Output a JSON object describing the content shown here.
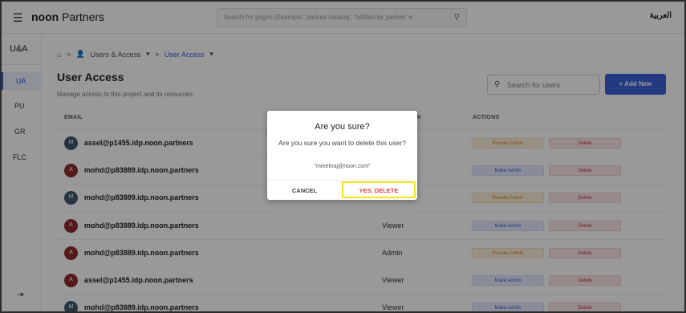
{
  "topbar": {
    "menu_icon": "hamburger-icon",
    "brand_bold": "noon",
    "brand_rest": " Partners",
    "search_placeholder": "Search for pages (Example: 'partner catalog', 'fulfilled by partner' e",
    "search_icon": "search-icon",
    "language": "العربية"
  },
  "rail": {
    "title": "U&A",
    "items": [
      {
        "label": "UA",
        "active": true
      },
      {
        "label": "PU"
      },
      {
        "label": "GR"
      },
      {
        "label": "FLC"
      }
    ],
    "collapse_label": "⇥"
  },
  "breadcrumb": {
    "home_icon": "home-icon",
    "sep": ">",
    "parent": "Users & Access",
    "current": "User Access",
    "chevron": "▾"
  },
  "page": {
    "title": "User Access",
    "subtitle": "Manage access to this project and its resources",
    "search_placeholder": "Search for users",
    "add_button": "+ Add New"
  },
  "table": {
    "headers": {
      "email": "EMAIL",
      "role": "N",
      "actions": "ACTIONS"
    },
    "rows": [
      {
        "initial": "M",
        "avatar_color": "#3e5a6e",
        "email": "assel@p1455.idp.noon.partners",
        "role": "",
        "admin_action": "Revoke Admin",
        "admin_type": "revoke",
        "delete": "Delete"
      },
      {
        "initial": "A",
        "avatar_color": "#8e2a2a",
        "email": "mohd@p83889.idp.noon.partners",
        "role": "",
        "admin_action": "Make Admin",
        "admin_type": "make",
        "delete": "Delete"
      },
      {
        "initial": "M",
        "avatar_color": "#3e5a6e",
        "email": "mohd@p83889.idp.noon.partners",
        "role": "",
        "admin_action": "Revoke Admin",
        "admin_type": "revoke",
        "delete": "Delete"
      },
      {
        "initial": "A",
        "avatar_color": "#8e2a2a",
        "email": "mohd@p83889.idp.noon.partners",
        "role": "Viewer",
        "admin_action": "Make Admin",
        "admin_type": "make",
        "delete": "Delete"
      },
      {
        "initial": "A",
        "avatar_color": "#8e2a2a",
        "email": "mohd@p83889.idp.noon.partners",
        "role": "Admin",
        "admin_action": "Revoke Admin",
        "admin_type": "revoke",
        "delete": "Delete"
      },
      {
        "initial": "A",
        "avatar_color": "#8e2a2a",
        "email": "assel@p1455.idp.noon.partners",
        "role": "Viewer",
        "admin_action": "Make Admin",
        "admin_type": "make",
        "delete": "Delete"
      },
      {
        "initial": "M",
        "avatar_color": "#3e5a6e",
        "email": "mohd@p83889.idp.noon.partners",
        "role": "Viewer",
        "admin_action": "Make Admin",
        "admin_type": "make",
        "delete": "Delete"
      }
    ]
  },
  "dialog": {
    "title": "Are you sure?",
    "message": "Are you sure you want to delete this user?",
    "email": "\"mmehraj@noon.com\"",
    "cancel": "CANCEL",
    "confirm": "YES, DELETE"
  },
  "colors": {
    "accent": "#3b62d6",
    "danger": "#e2453c",
    "highlight": "#f2e31b"
  }
}
